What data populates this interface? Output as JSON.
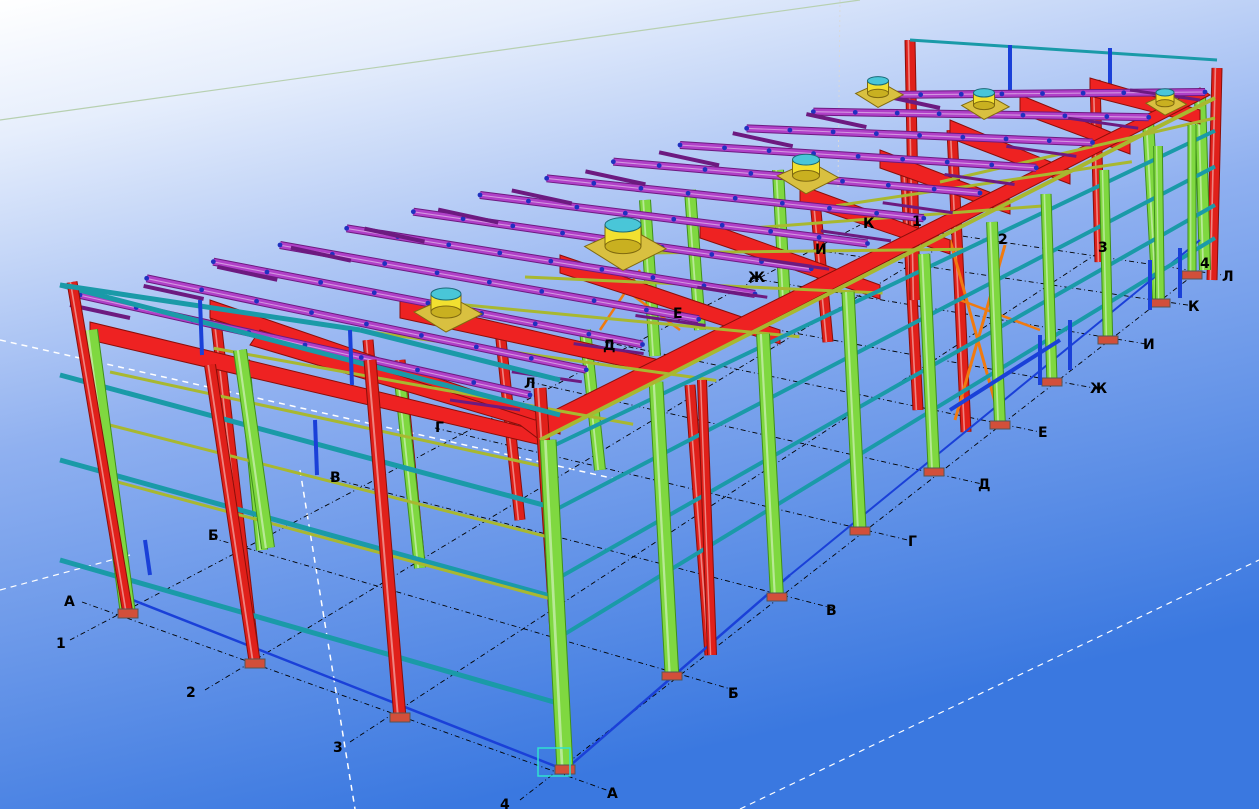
{
  "viewport": {
    "background_top": "#ffffff",
    "background_bottom": "#3a78e0"
  },
  "colors": {
    "column_green": "#7fd840",
    "column_green_dark": "#3f8f1a",
    "column_red": "#e0201a",
    "column_red_dark": "#8a0e0a",
    "rafter_red": "#ee2222",
    "purlin_purple": "#b040c8",
    "purlin_purple_dark": "#6d1a80",
    "rail_teal": "#1a9aa8",
    "brace_orange": "#f07a10",
    "brace_blue": "#1a40d8",
    "tie_olive": "#a8b830",
    "vent_yellow": "#f2e030",
    "bolt_blue": "#2030c0",
    "grid_line": "#000000"
  },
  "grid_axes": {
    "numbers_near": [
      "1",
      "2",
      "3",
      "4"
    ],
    "numbers_far": [
      "1",
      "2",
      "3",
      "4"
    ],
    "letters_right": [
      "А",
      "Б",
      "В",
      "Г",
      "Д",
      "Е",
      "Ж",
      "И",
      "К",
      "Л"
    ],
    "letters_left": [
      "А",
      "Б",
      "В",
      "Г",
      "Д",
      "Е",
      "Ж",
      "И",
      "К",
      "Л"
    ]
  },
  "vents": [
    {
      "name": "roof-ventilator-1"
    },
    {
      "name": "roof-ventilator-2"
    },
    {
      "name": "roof-ventilator-3"
    },
    {
      "name": "roof-ventilator-4"
    },
    {
      "name": "roof-ventilator-5"
    },
    {
      "name": "roof-ventilator-6"
    }
  ]
}
